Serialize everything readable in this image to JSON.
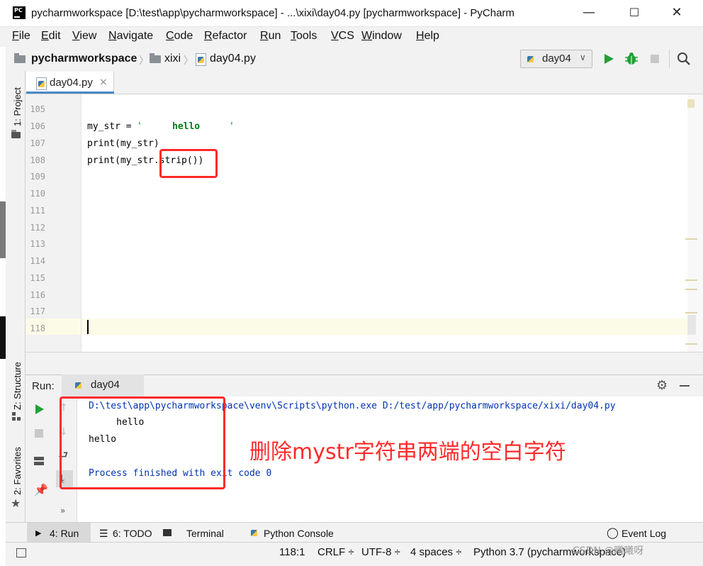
{
  "window": {
    "title": "pycharmworkspace [D:\\test\\app\\pycharmworkspace] - ...\\xixi\\day04.py [pycharmworkspace] - PyCharm",
    "app_icon_text": "PC",
    "controls": [
      "—",
      "☐",
      "✕"
    ]
  },
  "menu": [
    "File",
    "Edit",
    "View",
    "Navigate",
    "Code",
    "Refactor",
    "Run",
    "Tools",
    "VCS",
    "Window",
    "Help"
  ],
  "navbar": {
    "project": "pycharmworkspace",
    "folder": "xixi",
    "file": "day04.py",
    "run_config": "day04"
  },
  "left_tools": {
    "project": "1: Project",
    "structure": "Z: Structure",
    "favorites": "2: Favorites"
  },
  "editor": {
    "tab": "day04.py",
    "line_numbers": [
      "105",
      "106",
      "107",
      "108",
      "109",
      "110",
      "111",
      "112",
      "113",
      "114",
      "115",
      "116",
      "117",
      "118"
    ],
    "code": {
      "l106_var": "my_str = ",
      "l106_q1": "'",
      "l106_hello": "hello",
      "l106_q2": "'",
      "l107": "print(my_str)",
      "l108_a": "print(my_str.",
      "l108_b": "strip())"
    }
  },
  "run_panel": {
    "label": "Run:",
    "tab": "day04",
    "output": [
      "D:\\test\\app\\pycharmworkspace\\venv\\Scripts\\python.exe D:/test/app/pycharmworkspace/xixi/day04.py",
      "     hello",
      "hello",
      "",
      "Process finished with exit code 0"
    ],
    "more": "»"
  },
  "annotation": {
    "note": "删除mystr字符串两端的空白字符",
    "color": "#ff2a2a"
  },
  "bottom_tools": [
    "4: Run",
    "6: TODO",
    "Terminal",
    "Python Console",
    "Event Log"
  ],
  "status": {
    "position": "118:1",
    "line_sep": "CRLF ÷",
    "encoding": "UTF-8 ÷",
    "indent": "4 spaces ÷",
    "interpreter": "Python 3.7 (pycharmworkspace)",
    "watermark": "CSDN @曦曦呀"
  },
  "colors": {
    "string": "#067d17",
    "console_blue": "#0033b3",
    "run_green": "#21a038"
  }
}
